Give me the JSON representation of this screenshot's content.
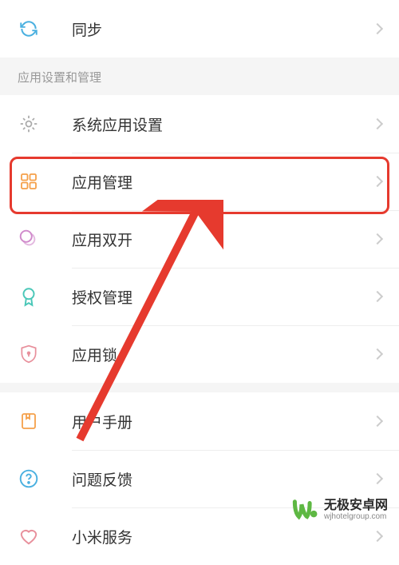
{
  "section1": {
    "sync": "同步"
  },
  "section2": {
    "header": "应用设置和管理",
    "systemApps": "系统应用设置",
    "appManagement": "应用管理",
    "dualApps": "应用双开",
    "permissions": "授权管理",
    "appLock": "应用锁"
  },
  "section3": {
    "userManual": "用户手册",
    "feedback": "问题反馈",
    "miService": "小米服务"
  },
  "watermark": {
    "main": "无极安卓网",
    "sub": "wjhotelgroup.com"
  },
  "colors": {
    "highlight": "#e63a2e",
    "iconOrange": "#f5a04a",
    "iconPurple": "#d08acb",
    "iconTeal": "#4ac7b8",
    "iconPink": "#e8909c",
    "iconBlue": "#4ab0e0",
    "iconGray": "#aaa"
  }
}
